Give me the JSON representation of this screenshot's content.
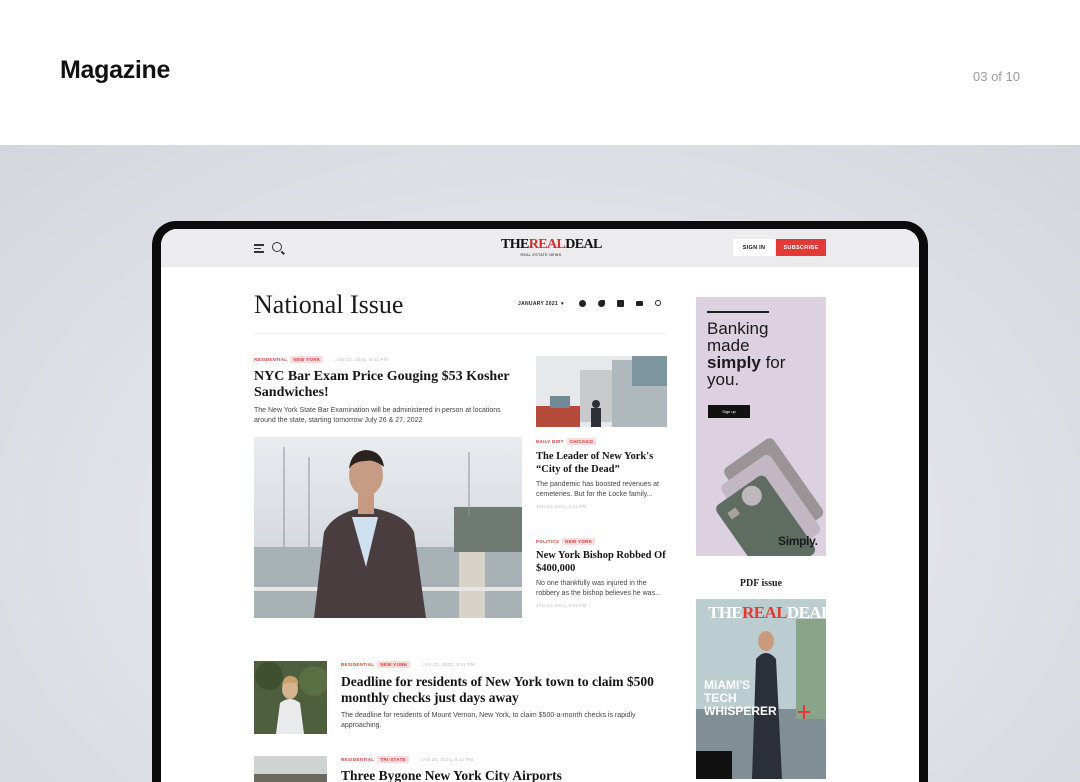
{
  "slide": {
    "title": "Magazine",
    "counter": "03 of 10"
  },
  "site": {
    "logo_prefix": "THE",
    "logo_accent": "REAL",
    "logo_suffix": "DEAL",
    "logo_tagline": "REAL ESTATE NEWS",
    "signin_label": "SIGN IN",
    "subscribe_label": "SUBSCRIBE"
  },
  "page": {
    "title": "National Issue",
    "date_filter": "JANUARY 2021"
  },
  "articles": [
    {
      "category": "RESIDENTIAL",
      "location": "NEW YORK",
      "date": "JAN 23, 2021, 9:11 PM",
      "headline": "NYC Bar Exam Price Gouging $53 Kosher Sandwiches!",
      "excerpt": "The New York State Bar Examination will be administered in person at locations around the state, starting tomorrow July 26 & 27, 2022"
    },
    {
      "category": "DAILY DIRT",
      "location": "CHICAGO",
      "headline": "The Leader of New York's “City of the Dead”",
      "excerpt": "The pandemic has boosted revenues at cemeteries. But for the Locke family...",
      "date": "JAN 23, 2021, 9:11 PM"
    },
    {
      "category": "POLITICS",
      "location": "NEW YORK",
      "headline": "New York Bishop Robbed Of $400,000",
      "excerpt": "No one thankfully was injured in the robbery as the bishop believes he was...",
      "date": "JAN 23, 2021, 9:11 PM"
    },
    {
      "category": "RESIDENTIAL",
      "location": "NEW YORK",
      "date": "JAN 23, 2021, 9:11 PM",
      "headline": "Deadline for residents of New York town to claim $500 monthly checks just days away",
      "excerpt": "The deadline for residents of Mount Vernon, New York, to claim $500-a-month checks is rapidly approaching."
    },
    {
      "category": "RESIDENTIAL",
      "location": "TRI-STATE",
      "date": "JAN 23, 2021, 9:11 PM",
      "headline": "Three Bygone New York City Airports"
    }
  ],
  "ad": {
    "line1": "Banking",
    "line2": "made",
    "line3_bold": "simply",
    "line3_rest": " for",
    "line4": "you.",
    "button": "Sign up",
    "brand": "Simply."
  },
  "pdf": {
    "label": "PDF issue",
    "cover_logo_prefix": "THE",
    "cover_logo_accent": "REAL",
    "cover_logo_suffix": "DEAL",
    "cover_headline_1": "MIAMI'S",
    "cover_headline_2": "TECH",
    "cover_headline_3": "WHISPERER"
  },
  "colors": {
    "accent": "#e23b36",
    "ad_bg": "#dcd0e1"
  }
}
